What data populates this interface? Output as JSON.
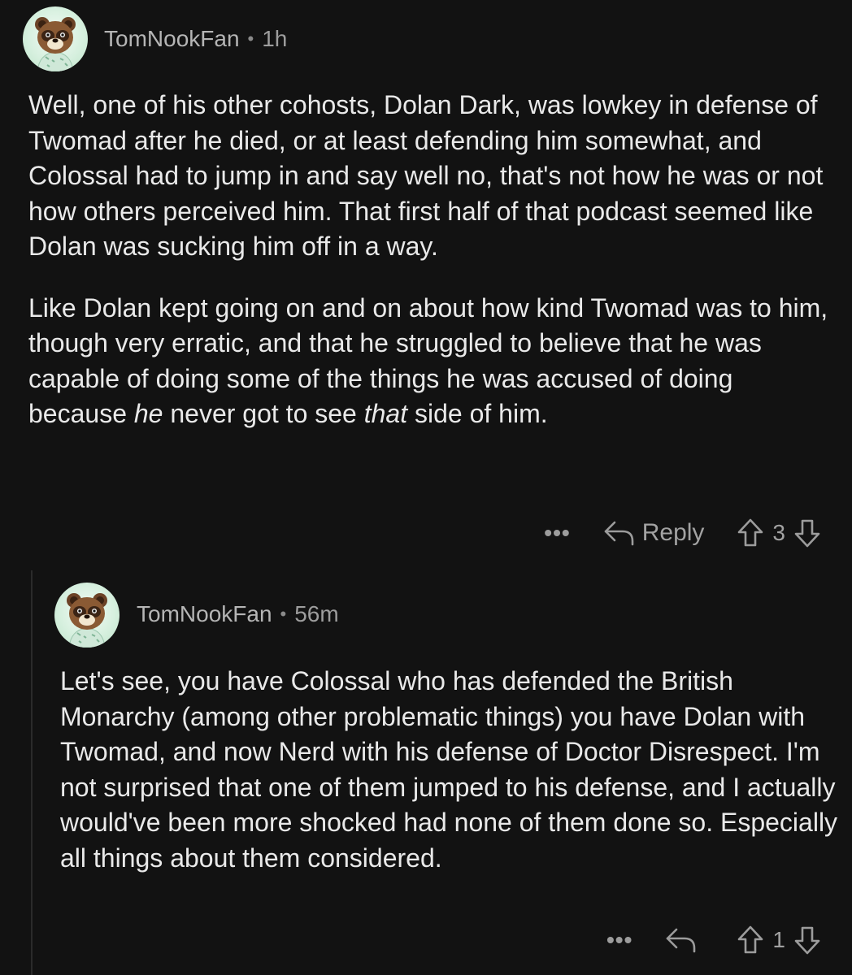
{
  "comments": [
    {
      "username": "TomNookFan",
      "separator": "•",
      "time": "1h",
      "paragraph1": "Well, one of his other cohosts, Dolan Dark, was lowkey in defense of Twomad after he died, or at least defending him somewhat, and Colossal had to jump in and say well no, that's not how he was or not how others perceived him. That first half of that podcast seemed like Dolan was sucking him off in a way.",
      "paragraph2_a": "Like Dolan kept going on and on about how kind Twomad was to him, though very erratic, and that he struggled to believe that he was capable of doing some of the things he was accused of doing because ",
      "paragraph2_em1": "he",
      "paragraph2_b": " never got to see ",
      "paragraph2_em2": "that",
      "paragraph2_c": " side of him.",
      "more_label": "•••",
      "reply_label": "Reply",
      "score": "3"
    },
    {
      "username": "TomNookFan",
      "separator": "•",
      "time": "56m",
      "text": "Let's see, you have Colossal who has defended the British Monarchy (among other problematic things) you have Dolan with Twomad, and now Nerd with his defense of Doctor Disrespect. I'm not surprised that one of them jumped to his defense, and I actually would've been more shocked had none of them done so. Especially all things about them considered.",
      "more_label": "•••",
      "score": "1"
    }
  ],
  "icons": {
    "avatar": "tom-nook-avatar",
    "reply": "reply-arrow-icon",
    "upvote": "upvote-arrow-icon",
    "downvote": "downvote-arrow-icon",
    "more": "more-dots-icon"
  },
  "colors": {
    "background": "#121212",
    "text": "#e9e9e9",
    "muted": "#a7a7a7"
  }
}
